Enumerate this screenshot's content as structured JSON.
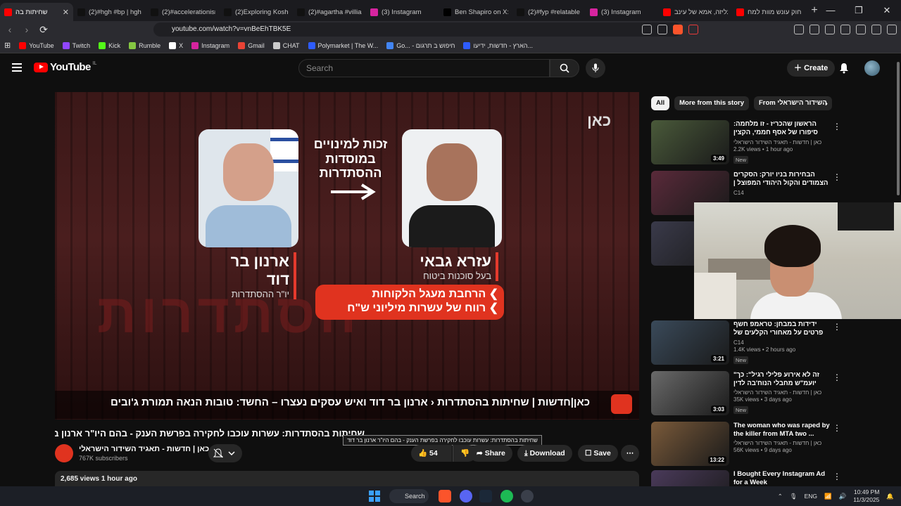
{
  "browser": {
    "tabs": [
      {
        "label": "שחיתות בה",
        "icon": "youtube",
        "color": "#ff0000",
        "active": true
      },
      {
        "label": "(2)#hgh #bp | hgh",
        "icon": "tiktok",
        "color": "#111111"
      },
      {
        "label": "(2)#accelerationism",
        "icon": "tiktok",
        "color": "#111111"
      },
      {
        "label": "(2)Exploring Koshe",
        "icon": "tiktok",
        "color": "#111111"
      },
      {
        "label": "(2)#agartha #villia",
        "icon": "tiktok",
        "color": "#111111"
      },
      {
        "label": "(3) Instagram",
        "icon": "instagram",
        "color": "#d6249f"
      },
      {
        "label": "Ben Shapiro on X: \"",
        "icon": "x",
        "color": "#000000"
      },
      {
        "label": "(2)#fyp #relatable",
        "icon": "tiktok",
        "color": "#111111"
      },
      {
        "label": "(3) Instagram",
        "icon": "instagram",
        "color": "#d6249f"
      },
      {
        "label": "עליזה, אמא של עינב",
        "icon": "youtube",
        "color": "#ff0000"
      },
      {
        "label": "חוק עונש מוות למח",
        "icon": "youtube",
        "color": "#ff0000"
      }
    ],
    "new_tab": "+",
    "url": "youtube.com/watch?v=vnBeEhTBK5E",
    "bookmarks": [
      {
        "label": "YouTube",
        "color": "#ff0000"
      },
      {
        "label": "Twitch",
        "color": "#9146ff"
      },
      {
        "label": "Kick",
        "color": "#53fc18"
      },
      {
        "label": "Rumble",
        "color": "#85c742"
      },
      {
        "label": "X",
        "color": "#ffffff"
      },
      {
        "label": "Instagram",
        "color": "#d6249f"
      },
      {
        "label": "Gmail",
        "color": "#ea4335"
      },
      {
        "label": "CHAT",
        "color": "#cccccc"
      },
      {
        "label": "Polymarket | The W...",
        "color": "#2e5cff"
      },
      {
        "label": "Go... - חיפוש ב תרגום",
        "color": "#4285f4"
      },
      {
        "label": "הארץ - חדשות, ידיעו...",
        "color": "#2e5cff"
      }
    ]
  },
  "youtube": {
    "logo_text": "YouTube",
    "country": "IL",
    "search_placeholder": "Search",
    "create_label": "Create",
    "video": {
      "kan_logo": "כאן",
      "bg_word": "הסתדרות",
      "center_caption": "זכות למינויים במוסדות ההסתדרות",
      "left_name": "ארנון בר דוד",
      "left_role": "יו\"ר ההסתדרות",
      "right_name": "עזרא גבאי",
      "right_role": "בעל סוכנות ביטוח",
      "points": [
        "הרחבת מעגל הלקוחות",
        "רווח של עשרות מיליוני ש\"ח"
      ],
      "ticker": "כאן|חדשות  |  שחיתות בהסתדרות ‹ ארנון בר דוד ואיש עסקים נעצרו – החשד: טובות הנאה תמורת ג'ובים"
    },
    "title": "שחיתות בהסתדרות: עשרות עוכבו לחקירה בפרשת הענק - בהם היו\"ר ארנון בר דוד",
    "tooltip": "שחיתות בהסתדרות: עשרות עוכבו לחקירה בפרשת הענק - בהם היו\"ר ארנון בר דוד",
    "channel": {
      "name": "כאן | חדשות - תאגיד השידור הישראלי",
      "subs": "767K subscribers"
    },
    "actions": {
      "likes": "54",
      "share": "Share",
      "download": "Download",
      "save": "Save"
    },
    "views_line": "2,685 views  1 hour ago",
    "chips": [
      "All",
      "More from this story",
      "From השידור הישראלי"
    ],
    "recs": [
      {
        "title": "הראשון שהכריז - זו מלחמה: סיפורו של אסף חממי, הקצין הבכיר ביותר",
        "channel": "כאן | חדשות - תאגיד השידור הישראלי",
        "meta": "2.2K views • 1 hour ago",
        "badge": "New",
        "dur": "3:49"
      },
      {
        "title": "הבחירות בניו יורק: הסקרים הצמודים והקול היהודי המפוצל | החדשות -",
        "channel": "C14",
        "meta": "",
        "badge": "",
        "dur": ""
      },
      {
        "title": "",
        "channel": "",
        "meta": "",
        "badge": "",
        "dur": ""
      },
      {
        "title": "ידידות במבחן: טראמפ חשף פרטים על מאחורי הקלעים של יחסיו עם",
        "channel": "C14",
        "meta": "1.4K views • 2 hours ago",
        "badge": "New",
        "dur": "3:21"
      },
      {
        "title": "\"זה לא אירוע פלילי רגיל\": כך יועמ\"ש מחבלי הנוח'בה לדין",
        "channel": "כאן | חדשות - תאגיד השידור הישראלי",
        "meta": "35K views • 3 days ago",
        "badge": "New",
        "dur": "3:03"
      },
      {
        "title": "The woman who was raped by the killer from MTA two ...",
        "channel": "כאן | חדשות - תאגיד השידור הישראלי",
        "meta": "56K views • 9 days ago",
        "badge": "",
        "dur": "13:22"
      },
      {
        "title": "I Bought Every Instagram Ad for a Week",
        "channel": "",
        "meta": "",
        "badge": "",
        "dur": ""
      }
    ]
  },
  "taskbar": {
    "search": "Search",
    "lang": "ENG",
    "time": "10:49 PM",
    "date": "11/3/2025"
  }
}
